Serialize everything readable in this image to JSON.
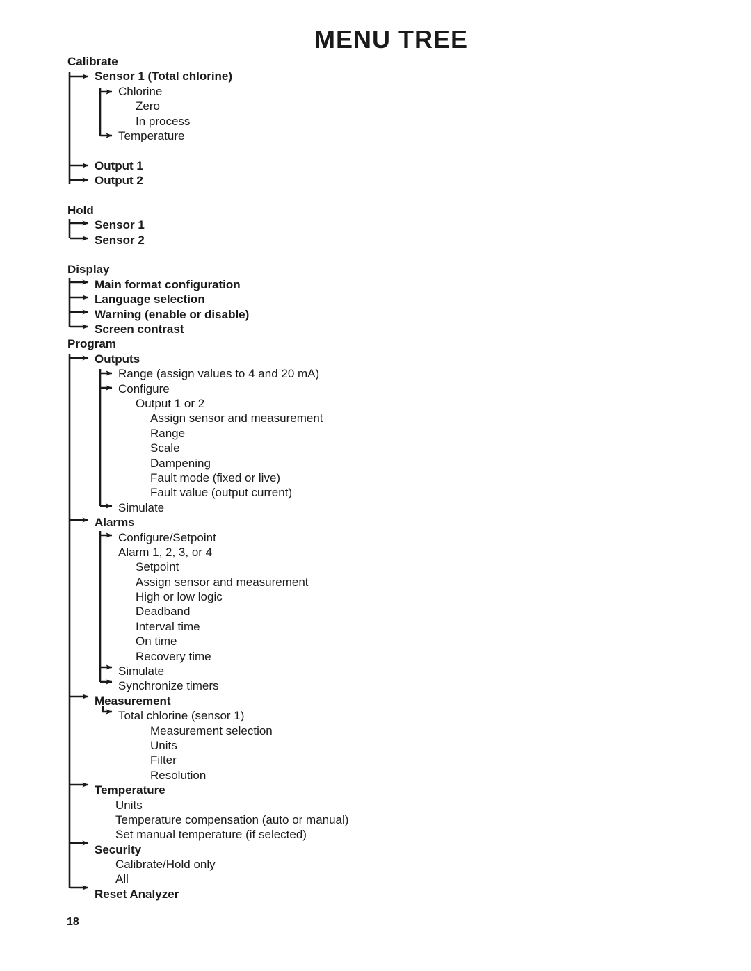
{
  "document": {
    "title": "MENU TREE",
    "page_number": "18"
  },
  "menu_tree": {
    "sections": [
      {
        "name": "Calibrate",
        "items": [
          "Sensor 1 (Total chlorine)",
          "Chlorine",
          "Zero",
          "In process",
          "Temperature",
          "Output 1",
          "Output 2"
        ]
      },
      {
        "name": "Hold",
        "items": [
          "Sensor 1",
          "Sensor 2"
        ]
      },
      {
        "name": "Display",
        "items": [
          "Main format configuration",
          "Language selection",
          "Warning (enable or disable)",
          "Screen contrast"
        ]
      },
      {
        "name": "Program",
        "items": [
          "Outputs",
          "Range (assign values to 4 and 20 mA)",
          "Configure",
          "Output 1 or 2",
          "Assign sensor and measurement",
          "Range",
          "Scale",
          "Dampening",
          "Fault mode (fixed or live)",
          "Fault value (output current)",
          "Simulate",
          "Alarms",
          "Configure/Setpoint",
          "Alarm 1, 2, 3, or 4",
          "Setpoint",
          "Assign sensor and measurement",
          "High or low logic",
          "Deadband",
          "Interval time",
          "On time",
          "Recovery time",
          "Simulate",
          "Synchronize timers",
          "Measurement",
          "Total chlorine (sensor 1)",
          "Measurement selection",
          "Units",
          "Filter",
          "Resolution",
          "Temperature",
          "Units",
          "Temperature compensation (auto or manual)",
          "Set manual temperature (if selected)",
          "Security",
          "Calibrate/Hold only",
          "All",
          "Reset Analyzer"
        ]
      }
    ],
    "rows": [
      {
        "text": "Calibrate",
        "level": "lv0",
        "bold": true
      },
      {
        "text": "Sensor 1 (Total chlorine)",
        "level": "lv1",
        "bold": true
      },
      {
        "text": "Chlorine",
        "level": "lv2",
        "bold": false
      },
      {
        "text": "Zero",
        "level": "lv3",
        "bold": false
      },
      {
        "text": "In process",
        "level": "lv3",
        "bold": false
      },
      {
        "text": "Temperature",
        "level": "lv2",
        "bold": false
      },
      {
        "text": "Output 1",
        "level": "lv1",
        "bold": true
      },
      {
        "text": "Output 2",
        "level": "lv1",
        "bold": true
      },
      {
        "text": "Hold",
        "level": "lv0",
        "bold": true
      },
      {
        "text": "Sensor 1",
        "level": "lv1",
        "bold": true
      },
      {
        "text": "Sensor 2",
        "level": "lv1",
        "bold": true
      },
      {
        "text": "Display",
        "level": "lv0",
        "bold": true
      },
      {
        "text": "Main format configuration",
        "level": "lv1",
        "bold": true
      },
      {
        "text": "Language selection",
        "level": "lv1",
        "bold": true
      },
      {
        "text": "Warning (enable or disable)",
        "level": "lv1",
        "bold": true
      },
      {
        "text": "Screen contrast",
        "level": "lv1",
        "bold": true
      },
      {
        "text": "Program",
        "level": "lv0",
        "bold": true
      },
      {
        "text": "Outputs",
        "level": "lv1",
        "bold": true
      },
      {
        "text": "Range (assign values to 4 and 20 mA)",
        "level": "lv2",
        "bold": false
      },
      {
        "text": "Configure",
        "level": "lv2",
        "bold": false
      },
      {
        "text": "Output 1 or 2",
        "level": "lv3",
        "bold": false
      },
      {
        "text": "Assign sensor and measurement",
        "level": "lv4",
        "bold": false
      },
      {
        "text": "Range",
        "level": "lv4",
        "bold": false
      },
      {
        "text": "Scale",
        "level": "lv4",
        "bold": false
      },
      {
        "text": "Dampening",
        "level": "lv4",
        "bold": false
      },
      {
        "text": "Fault mode (fixed or live)",
        "level": "lv4",
        "bold": false
      },
      {
        "text": "Fault value (output current)",
        "level": "lv4",
        "bold": false
      },
      {
        "text": "Simulate",
        "level": "lv2",
        "bold": false
      },
      {
        "text": "Alarms",
        "level": "lv1",
        "bold": true
      },
      {
        "text": "Configure/Setpoint",
        "level": "lv2",
        "bold": false
      },
      {
        "text": "Alarm 1, 2, 3, or 4",
        "level": "lv2",
        "bold": false
      },
      {
        "text": "Setpoint",
        "level": "lv3",
        "bold": false
      },
      {
        "text": "Assign sensor and measurement",
        "level": "lv3",
        "bold": false
      },
      {
        "text": "High or low logic",
        "level": "lv3",
        "bold": false
      },
      {
        "text": "Deadband",
        "level": "lv3",
        "bold": false
      },
      {
        "text": "Interval time",
        "level": "lv3",
        "bold": false
      },
      {
        "text": "On time",
        "level": "lv3",
        "bold": false
      },
      {
        "text": "Recovery time",
        "level": "lv3",
        "bold": false
      },
      {
        "text": "Simulate",
        "level": "lv2",
        "bold": false
      },
      {
        "text": "Synchronize timers",
        "level": "lv2",
        "bold": false
      },
      {
        "text": "Measurement",
        "level": "lv1",
        "bold": true
      },
      {
        "text": "Total chlorine (sensor 1)",
        "level": "lv2",
        "bold": false
      },
      {
        "text": "Measurement selection",
        "level": "lv4",
        "bold": false
      },
      {
        "text": "Units",
        "level": "lv4",
        "bold": false
      },
      {
        "text": "Filter",
        "level": "lv4",
        "bold": false
      },
      {
        "text": "Resolution",
        "level": "lv4",
        "bold": false
      },
      {
        "text": "Temperature",
        "level": "lv1",
        "bold": true
      },
      {
        "text": "Units",
        "level": "lv1b",
        "bold": false
      },
      {
        "text": "Temperature compensation (auto or manual)",
        "level": "lv1b",
        "bold": false
      },
      {
        "text": "Set manual temperature (if selected)",
        "level": "lv1b",
        "bold": false
      },
      {
        "text": "Security",
        "level": "lv1",
        "bold": true
      },
      {
        "text": "Calibrate/Hold only",
        "level": "lv1b",
        "bold": false
      },
      {
        "text": "All",
        "level": "lv1b",
        "bold": false
      },
      {
        "text": "Reset Analyzer",
        "level": "lv1",
        "bold": true
      }
    ]
  },
  "colors": {
    "text": "#1a1a1a",
    "line": "#1a1a1a",
    "background": "#ffffff"
  }
}
